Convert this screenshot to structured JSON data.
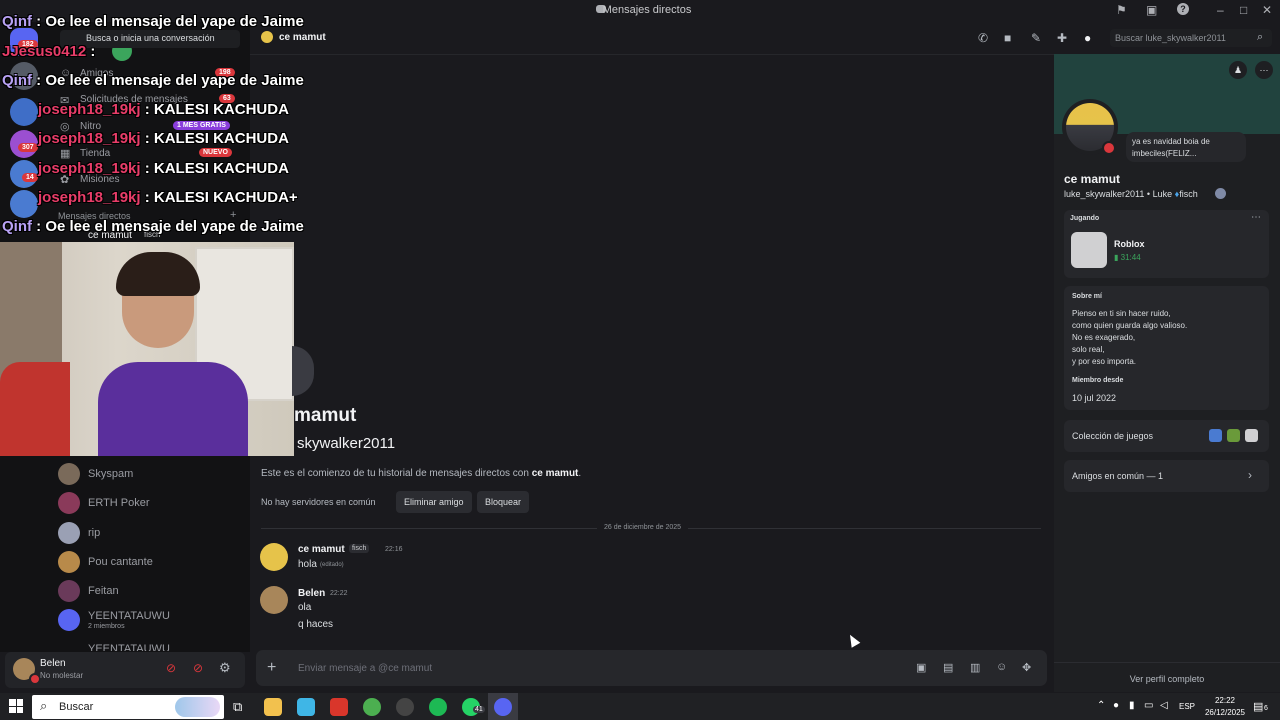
{
  "window": {
    "title": "Mensajes directos"
  },
  "sidebar": {
    "search_placeholder": "Busca o inicia una conversación",
    "nav": [
      {
        "label": "Amigos",
        "badge": "198"
      },
      {
        "label": "Solicitudes de mensajes",
        "badge": "63"
      },
      {
        "label": "Nitro",
        "badge": "1 MES GRATIS"
      },
      {
        "label": "Tienda",
        "badge": "NUEVO"
      },
      {
        "label": "Misiones",
        "badge": ""
      }
    ],
    "dm_header": "Mensajes directos",
    "active_dm": "ce mamut",
    "active_dm_tag": "fisch",
    "dms": [
      {
        "name": "Skyspam",
        "color": "#7a6a5a"
      },
      {
        "name": "ERTH Poker",
        "color": "#8a3a5a"
      },
      {
        "name": "rip",
        "color": "#9aa0b4"
      },
      {
        "name": "Pou cantante",
        "color": "#b88a4a"
      },
      {
        "name": "Feitan",
        "color": "#6a3a5a"
      },
      {
        "name": "YEENTATAUWU",
        "sub": "2 miembros",
        "color": "#5865f2"
      },
      {
        "name": "YEENTATAUWU",
        "color": "#444"
      }
    ],
    "server_badges": [
      "182",
      "307",
      "14"
    ]
  },
  "overlay": [
    {
      "user": "Qinf",
      "style": "u1",
      "text": ": Oe lee el mensaje del yape de Jaime"
    },
    {
      "user": "JJesus0412",
      "style": "u2",
      "text": ":"
    },
    {
      "user": "Qinf",
      "style": "u1",
      "text": ": Oe lee el mensaje del yape de Jaime"
    },
    {
      "user": "joseph18_19kj",
      "style": "u2",
      "text": ": KALESI KACHUDA"
    },
    {
      "user": "joseph18_19kj",
      "style": "u2",
      "text": ": KALESI KACHUDA"
    },
    {
      "user": "joseph18_19kj",
      "style": "u2",
      "text": ": KALESI KACHUDA"
    },
    {
      "user": "joseph18_19kj",
      "style": "u2",
      "text": ": KALESI KACHUDA+"
    },
    {
      "user": "Qinf",
      "style": "u1",
      "text": ": Oe lee el mensaje del yape de Jaime"
    }
  ],
  "user_panel": {
    "name": "Belen",
    "status": "No molestar"
  },
  "header": {
    "channel": "ce mamut",
    "search_placeholder": "Buscar luke_skywalker2011"
  },
  "intro": {
    "display_name": "mamut",
    "username": "skywalker2011",
    "text_prefix": "Este es el comienzo de tu historial de mensajes directos con ",
    "text_name": "ce mamut",
    "text_suffix": ".",
    "no_servers": "No hay servidores en común",
    "remove_friend": "Eliminar amigo",
    "block": "Bloquear"
  },
  "divider_date": "26 de diciembre de 2025",
  "messages": [
    {
      "author": "ce mamut",
      "tag": "fisch",
      "time": "22:16",
      "lines": [
        "hola"
      ],
      "edited": "(editado)",
      "color": "#e6c34a"
    },
    {
      "author": "Belen",
      "tag": "",
      "time": "22:22",
      "lines": [
        "ola",
        "q haces"
      ],
      "edited": "",
      "color": "#a8865a"
    }
  ],
  "composer": {
    "placeholder": "Enviar mensaje a @ce mamut"
  },
  "profile": {
    "status_bubble": "ya es navidad boia de imbeciles(FELIZ...",
    "display_name": "ce mamut",
    "username": "luke_skywalker2011",
    "pronoun_sep": "•",
    "alt_name": "Luke",
    "tag": "fisch",
    "playing_label": "Jugando",
    "game": "Roblox",
    "game_time": "31:44",
    "about_title": "Sobre mí",
    "about_lines": [
      "Pienso en ti sin hacer ruido,",
      "como quien guarda algo valioso.",
      "No es exagerado,",
      "solo real,",
      "y por eso importa."
    ],
    "member_since_title": "Miembro desde",
    "member_since": "10 jul 2022",
    "games_collection": "Colección de juegos",
    "mutual_friends": "Amigos en común — 1",
    "view_full": "Ver perfil completo"
  },
  "taskbar": {
    "search": "Buscar",
    "lang": "ESP",
    "time": "22:22",
    "date": "26/12/2025",
    "whatsapp_badge": "41",
    "notif": "6"
  }
}
